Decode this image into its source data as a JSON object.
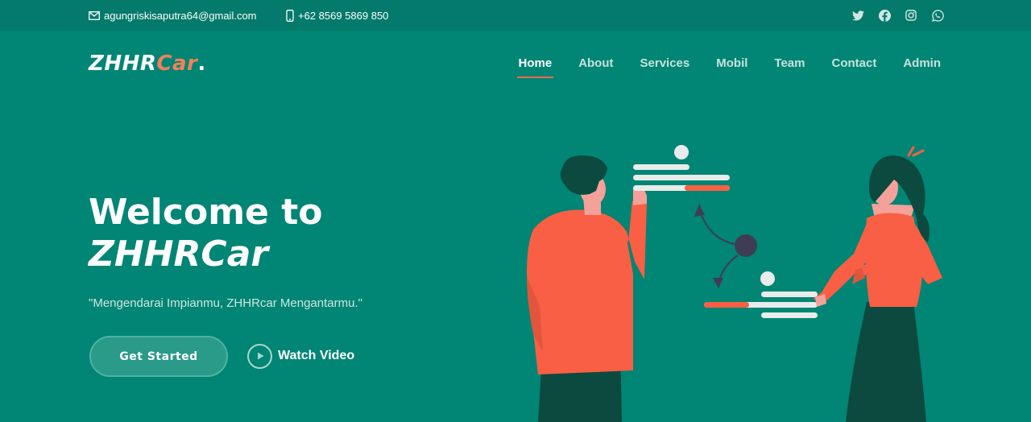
{
  "topbar": {
    "email": "agungriskisaputra64@gmail.com",
    "phone": "+62 8569 5869 850",
    "socials": [
      "twitter-icon",
      "facebook-icon",
      "instagram-icon",
      "whatsapp-icon"
    ]
  },
  "header": {
    "logo_main": "ZHHR",
    "logo_accent": "Car",
    "logo_dot": ".",
    "nav": [
      "Home",
      "About",
      "Services",
      "Mobil",
      "Team",
      "Contact",
      "Admin"
    ],
    "active_nav": "Home"
  },
  "hero": {
    "title_line1": "Welcome to",
    "title_line2": "ZHHRCar",
    "tagline": "\"Mengendarai Impianmu, ZHHRcar Mengantarmu.\"",
    "cta_label": "Get Started",
    "watch_label": "Watch Video"
  },
  "colors": {
    "background": "#018574",
    "topbar": "#037a6b",
    "accent": "#f2805a",
    "figure_shirt": "#f95f44",
    "figure_dark": "#0c4a40"
  }
}
